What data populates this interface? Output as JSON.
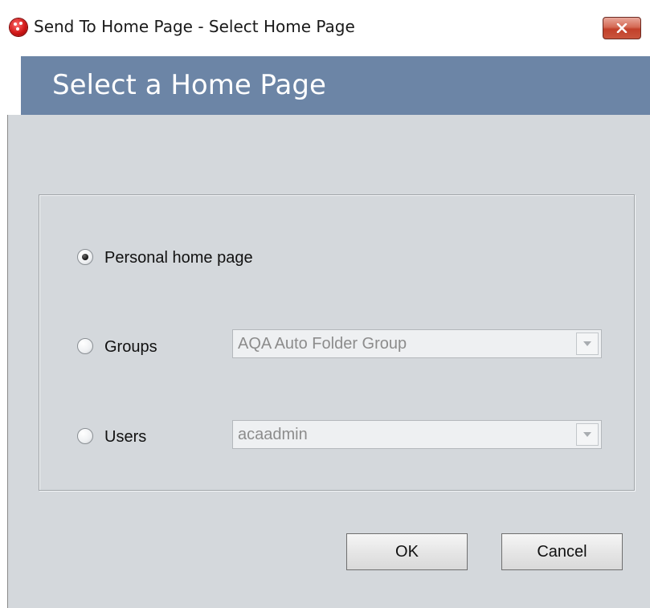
{
  "window": {
    "title": "Send To Home Page - Select Home Page",
    "icon": "app-logo-icon",
    "close_icon": "close-icon"
  },
  "header": {
    "title": "Select a Home Page",
    "band_color": "#6c85a6"
  },
  "options": {
    "personal": {
      "label": "Personal home page",
      "selected": true
    },
    "groups": {
      "label": "Groups",
      "selected": false,
      "value": "AQA Auto Folder Group",
      "enabled": false
    },
    "users": {
      "label": "Users",
      "selected": false,
      "value": "acaadmin",
      "enabled": false
    }
  },
  "buttons": {
    "ok_label": "OK",
    "cancel_label": "Cancel"
  }
}
